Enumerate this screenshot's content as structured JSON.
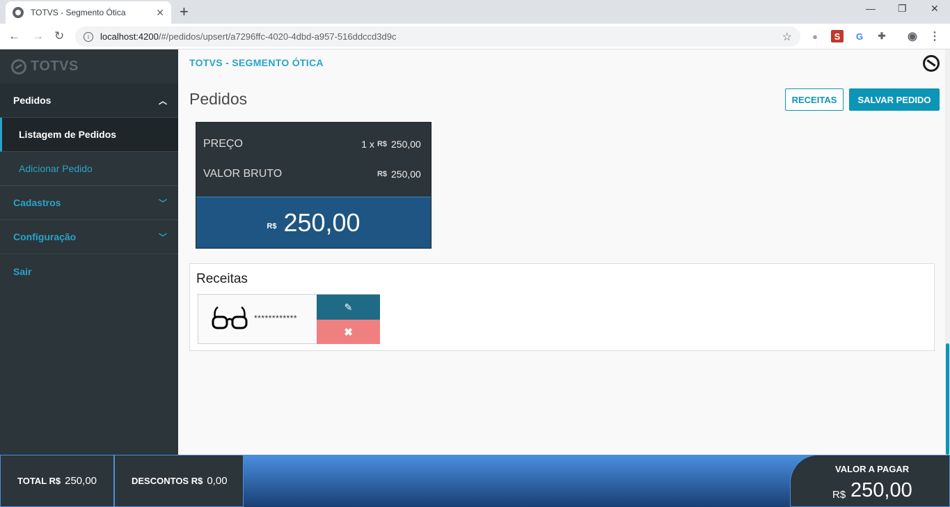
{
  "browser": {
    "tab_title": "TOTVS - Segmento Ótica",
    "url_host": "localhost:4200",
    "url_path": "/#/pedidos/upsert/a7296ffc-4020-4dbd-a957-516ddccd3d9c"
  },
  "sidebar": {
    "logo_text": "TOTVS",
    "items": [
      {
        "label": "Pedidos"
      },
      {
        "label": "Listagem de Pedidos"
      },
      {
        "label": "Adicionar Pedido"
      },
      {
        "label": "Cadastros"
      },
      {
        "label": "Configuração"
      },
      {
        "label": "Sair"
      }
    ]
  },
  "header": {
    "brand": "TOTVS - SEGMENTO ÓTICA",
    "page_title": "Pedidos",
    "receitas_button": "RECEITAS",
    "save_button": "SALVAR PEDIDO"
  },
  "price_card": {
    "preco_label": "PREÇO",
    "preco_qty": "1 x",
    "currency": "R$",
    "preco_value": "250,00",
    "bruto_label": "VALOR BRUTO",
    "bruto_value": "250,00",
    "total_value": "250,00"
  },
  "receitas": {
    "title": "Receitas",
    "items": [
      {
        "masked": "************"
      }
    ]
  },
  "footer": {
    "total_label": "TOTAL R$",
    "total_value": "250,00",
    "descontos_label": "DESCONTOS R$",
    "descontos_value": "0,00",
    "pagar_label": "VALOR A PAGAR",
    "pagar_currency": "R$",
    "pagar_value": "250,00"
  },
  "colors": {
    "accent": "#0c95b6",
    "sidebar": "#2c3539",
    "price_total": "#1e5582",
    "delete": "#f08080"
  }
}
